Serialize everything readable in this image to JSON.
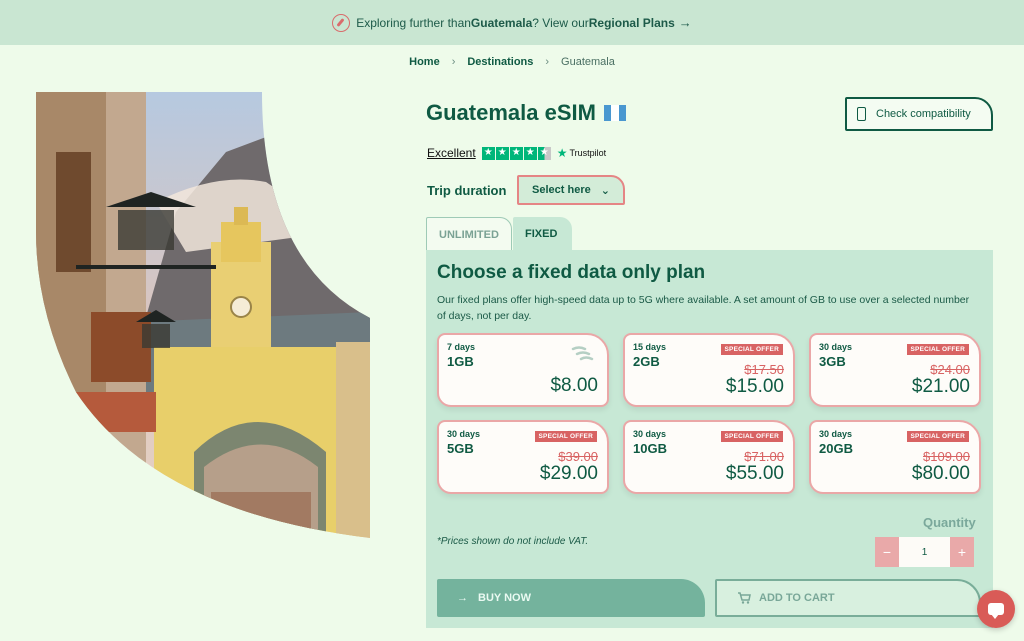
{
  "banner": {
    "prefix": "Exploring further than ",
    "country": "Guatemala",
    "middle": "? View our ",
    "link": "Regional Plans",
    "arrow": "→"
  },
  "breadcrumb": {
    "home": "Home",
    "destinations": "Destinations",
    "current": "Guatemala",
    "sep": "›"
  },
  "product": {
    "title": "Guatemala eSIM",
    "check_compat": "Check compatibility"
  },
  "trustpilot": {
    "rating_text": "Excellent",
    "brand": "Trustpilot",
    "stars": 4.5
  },
  "trip": {
    "label": "Trip duration",
    "select": "Select here",
    "chevron": "⌄"
  },
  "tabs": {
    "unlimited": "UNLIMITED",
    "fixed": "FIXED"
  },
  "plans": {
    "heading": "Choose a fixed data only plan",
    "description": "Our fixed plans offer high-speed data up to 5G where available. A set amount of GB to use over a selected number of days, not per day.",
    "offer_label": "SPECIAL OFFER",
    "cards": [
      {
        "days": "7 days",
        "gb": "1GB",
        "old": "",
        "price": "$8.00",
        "offer": false
      },
      {
        "days": "15 days",
        "gb": "2GB",
        "old": "$17.50",
        "price": "$15.00",
        "offer": true
      },
      {
        "days": "30 days",
        "gb": "3GB",
        "old": "$24.00",
        "price": "$21.00",
        "offer": true
      },
      {
        "days": "30 days",
        "gb": "5GB",
        "old": "$39.00",
        "price": "$29.00",
        "offer": true
      },
      {
        "days": "30 days",
        "gb": "10GB",
        "old": "$71.00",
        "price": "$55.00",
        "offer": true
      },
      {
        "days": "30 days",
        "gb": "20GB",
        "old": "$109.00",
        "price": "$80.00",
        "offer": true
      }
    ]
  },
  "quantity": {
    "label": "Quantity",
    "value": "1",
    "minus": "−",
    "plus": "+"
  },
  "vat_note": "*Prices shown do not include VAT.",
  "actions": {
    "buy": "BUY NOW",
    "cart": "ADD TO CART",
    "buy_arrow": "→"
  },
  "colors": {
    "accent": "#0f5a43",
    "offer": "#d86363",
    "panel": "#c7e8d5"
  }
}
